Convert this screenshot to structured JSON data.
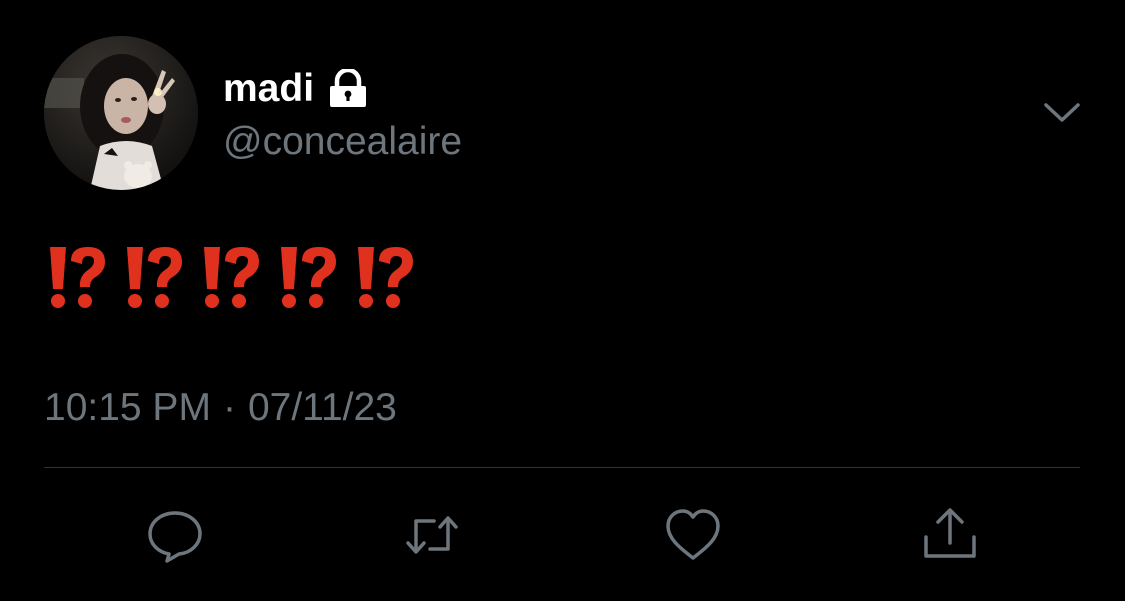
{
  "tweet": {
    "author": {
      "display_name": "madi",
      "handle": "@concealaire",
      "protected_icon": "lock-icon",
      "avatar": "avatar-photo"
    },
    "text_glyphs": [
      "⁉",
      "⁉",
      "⁉",
      "⁉",
      "⁉"
    ],
    "time": "10:15 PM",
    "separator": "·",
    "date": "07/11/23",
    "menu_icon": "chevron-down-icon"
  },
  "actions": [
    {
      "name": "reply",
      "icon": "comment-icon"
    },
    {
      "name": "retweet",
      "icon": "retweet-icon"
    },
    {
      "name": "like",
      "icon": "heart-icon"
    },
    {
      "name": "share",
      "icon": "share-icon"
    }
  ],
  "colors": {
    "background": "#000000",
    "primary_text": "#ffffff",
    "secondary_text": "#6e767d",
    "divider": "#2f3336",
    "emoji_red": "#e0301e"
  }
}
